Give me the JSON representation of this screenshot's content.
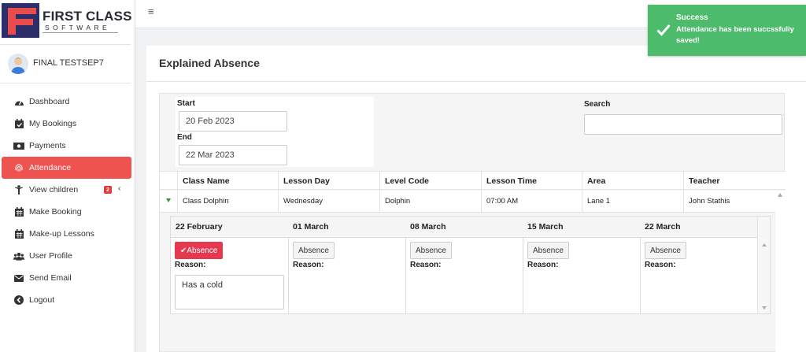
{
  "brand": {
    "title": "FIRST CLASS",
    "subtitle": "SOFTWARE"
  },
  "user": {
    "name": "FINAL TESTSEP7"
  },
  "sidebar": {
    "items": [
      {
        "label": "Dashboard",
        "icon": "dashboard-icon"
      },
      {
        "label": "My Bookings",
        "icon": "calendar-check-icon"
      },
      {
        "label": "Payments",
        "icon": "money-icon"
      },
      {
        "label": "Attendance",
        "icon": "fingerprint-icon",
        "active": true
      },
      {
        "label": "View children",
        "icon": "child-icon",
        "badge": "2"
      },
      {
        "label": "Make Booking",
        "icon": "calendar-icon"
      },
      {
        "label": "Make-up Lessons",
        "icon": "calendar-icon"
      },
      {
        "label": "User Profile",
        "icon": "users-icon"
      },
      {
        "label": "Send Email",
        "icon": "envelope-icon"
      },
      {
        "label": "Logout",
        "icon": "logout-icon"
      }
    ]
  },
  "toast": {
    "title": "Success",
    "message": "Attendance has been succssfully saved!",
    "color": "#4cbb6c"
  },
  "page": {
    "title": "Explained Absence"
  },
  "filters": {
    "start_label": "Start",
    "start_value": "20 Feb 2023",
    "end_label": "End",
    "end_value": "22 Mar 2023",
    "search_label": "Search",
    "search_value": ""
  },
  "table": {
    "columns": [
      "Class Name",
      "Lesson Day",
      "Level Code",
      "Lesson Time",
      "Area",
      "Teacher"
    ],
    "row": [
      "Class Dolphin",
      "Wednesday",
      "Dolphin",
      "07:00 AM",
      "Lane 1",
      "John Stathis"
    ]
  },
  "attendance": {
    "dates": [
      "22 February",
      "01 March",
      "08 March",
      "15 March",
      "22 March"
    ],
    "button_label": "Absence",
    "reason_label": "Reason:",
    "first_reason": "Has a cold",
    "marked_color": "#e53950"
  }
}
